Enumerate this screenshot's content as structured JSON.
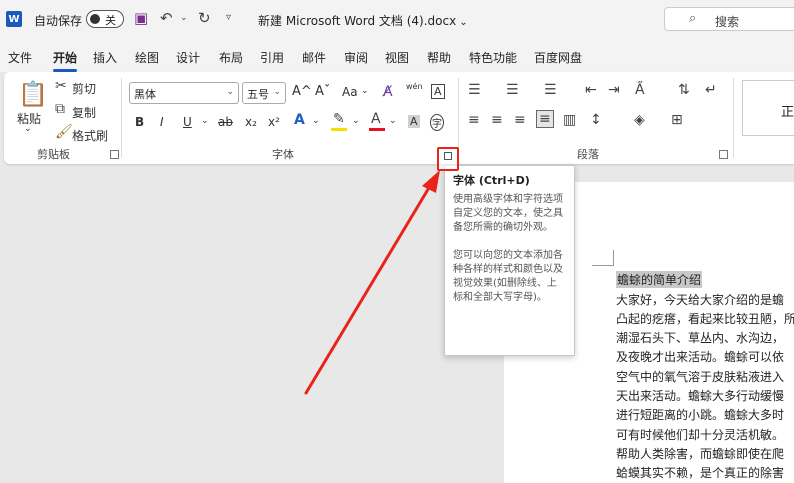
{
  "app": {
    "logo_letter": "W",
    "autosave_label": "自动保存",
    "autosave_state": "关",
    "doc_title": "新建 Microsoft Word 文档 (4).docx",
    "title_chevron": "⌄",
    "search_placeholder": "搜索"
  },
  "tabs": [
    "文件",
    "开始",
    "插入",
    "绘图",
    "设计",
    "布局",
    "引用",
    "邮件",
    "审阅",
    "视图",
    "帮助",
    "特色功能",
    "百度网盘"
  ],
  "clipboard": {
    "paste": "粘贴",
    "cut": "剪切",
    "copy": "复制",
    "format_painter": "格式刷",
    "group": "剪贴板"
  },
  "font": {
    "font_name": "黑体",
    "font_size": "五号",
    "group": "字体",
    "grow": "A^",
    "shrink": "Aˇ",
    "case": "Aa",
    "pinyin": "wén",
    "border_char": "A",
    "circle_char": "字",
    "bold": "B",
    "italic": "I",
    "underline": "U",
    "strike": "ab",
    "subscript": "x₂",
    "superscript": "x²"
  },
  "paragraph": {
    "group": "段落"
  },
  "styles": {
    "normal": "正"
  },
  "tooltip": {
    "title": "字体 (Ctrl+D)",
    "p1": "使用高级字体和字符选项自定义您的文本，使之具备您所需的确切外观。",
    "p2": "您可以向您的文本添加各种各样的样式和颜色以及视觉效果(如删除线、上标和全部大写字母)。"
  },
  "document": {
    "heading": "蟾蜍的简单介绍",
    "lines": [
      "大家好，今天给大家介绍的是蟾",
      "凸起的疙瘩，看起来比较丑陋，所",
      "潮湿石头下、草丛内、水沟边，",
      "及夜晚才出来活动。蟾蜍可以依",
      "空气中的氧气溶于皮肤粘液进入",
      "天出来活动。蟾蜍大多行动缓慢",
      "进行短距离的小跳。蟾蜍大多时",
      "可有时候他们却十分灵活机敏。",
      "帮助人类除害，而蟾蜍即使在爬",
      "蛤蟆其实不赖，是个真正的除害"
    ]
  },
  "colors": {
    "accent": "#185abd",
    "callout": "#e8231a",
    "highlight": "#f5e100",
    "font_color": "#e81123"
  }
}
